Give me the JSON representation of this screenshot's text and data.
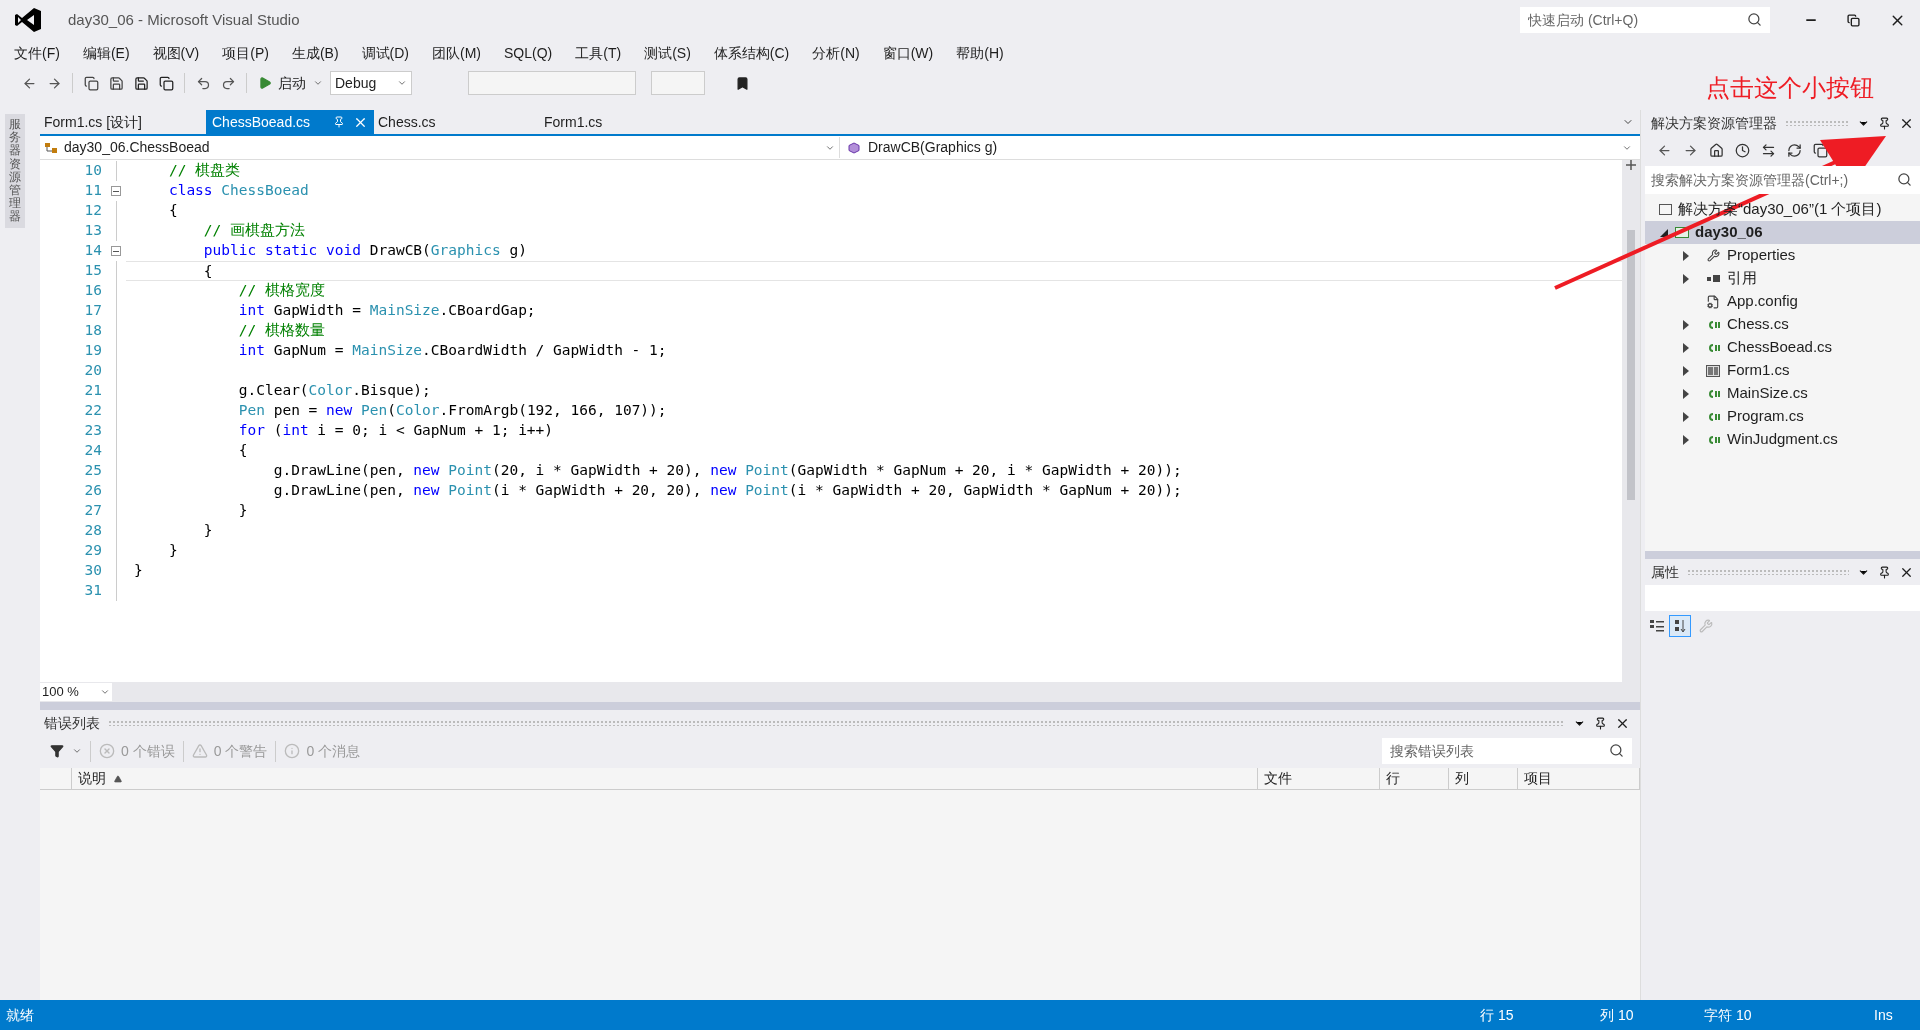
{
  "window": {
    "title": "day30_06 - Microsoft Visual Studio",
    "quick_launch": {
      "placeholder": "快速启动 (Ctrl+Q)"
    }
  },
  "menu": [
    "文件(F)",
    "编辑(E)",
    "视图(V)",
    "项目(P)",
    "生成(B)",
    "调试(D)",
    "团队(M)",
    "SQL(Q)",
    "工具(T)",
    "测试(S)",
    "体系结构(C)",
    "分析(N)",
    "窗口(W)",
    "帮助(H)"
  ],
  "toolbar": {
    "start_label": "启动",
    "configuration": "Debug"
  },
  "annotation": {
    "text": "点击这个小按钮"
  },
  "side_tab": "服务器资源管理器",
  "editor_tabs": [
    {
      "label": "Form1.cs [设计]",
      "selected": false
    },
    {
      "label": "ChessBoead.cs",
      "selected": true
    },
    {
      "label": "Chess.cs",
      "selected": false
    },
    {
      "label": "Form1.cs",
      "selected": false
    }
  ],
  "nav": {
    "type": "day30_06.ChessBoead",
    "member": "DrawCB(Graphics g)"
  },
  "code_lines": [
    {
      "number": "10",
      "current": false,
      "fold": false,
      "tokens": [
        {
          "kind": "comment",
          "text": "    // 棋盘类"
        }
      ]
    },
    {
      "number": "11",
      "current": false,
      "fold": true,
      "tokens": [
        {
          "kind": "keyword",
          "text": "    class"
        },
        {
          "kind": "type",
          "text": " ChessBoead"
        }
      ]
    },
    {
      "number": "12",
      "current": false,
      "fold": false,
      "tokens": [
        {
          "kind": "plain",
          "text": "    {"
        }
      ]
    },
    {
      "number": "13",
      "current": false,
      "fold": false,
      "tokens": [
        {
          "kind": "comment",
          "text": "        // 画棋盘方法"
        }
      ]
    },
    {
      "number": "14",
      "current": false,
      "fold": true,
      "tokens": [
        {
          "kind": "keyword",
          "text": "        public static void"
        },
        {
          "kind": "plain",
          "text": " DrawCB("
        },
        {
          "kind": "type",
          "text": "Graphics"
        },
        {
          "kind": "plain",
          "text": " g)"
        }
      ]
    },
    {
      "number": "15",
      "current": true,
      "fold": false,
      "tokens": [
        {
          "kind": "plain",
          "text": "        {"
        }
      ]
    },
    {
      "number": "16",
      "current": false,
      "fold": false,
      "tokens": [
        {
          "kind": "comment",
          "text": "            // 棋格宽度"
        }
      ]
    },
    {
      "number": "17",
      "current": false,
      "fold": false,
      "tokens": [
        {
          "kind": "keyword",
          "text": "            int"
        },
        {
          "kind": "plain",
          "text": " GapWidth = "
        },
        {
          "kind": "type",
          "text": "MainSize"
        },
        {
          "kind": "plain",
          "text": ".CBoardGap;"
        }
      ]
    },
    {
      "number": "18",
      "current": false,
      "fold": false,
      "tokens": [
        {
          "kind": "comment",
          "text": "            // 棋格数量"
        }
      ]
    },
    {
      "number": "19",
      "current": false,
      "fold": false,
      "tokens": [
        {
          "kind": "keyword",
          "text": "            int"
        },
        {
          "kind": "plain",
          "text": " GapNum = "
        },
        {
          "kind": "type",
          "text": "MainSize"
        },
        {
          "kind": "plain",
          "text": ".CBoardWidth / GapWidth - 1;"
        }
      ]
    },
    {
      "number": "20",
      "current": false,
      "fold": false
    },
    {
      "number": "21",
      "current": false,
      "fold": false,
      "tokens": [
        {
          "kind": "plain",
          "text": "            g.Clear("
        },
        {
          "kind": "type",
          "text": "Color"
        },
        {
          "kind": "plain",
          "text": ".Bisque);"
        }
      ]
    },
    {
      "number": "22",
      "current": false,
      "fold": false,
      "tokens": [
        {
          "kind": "type",
          "text": "            Pen"
        },
        {
          "kind": "plain",
          "text": " pen = "
        },
        {
          "kind": "keyword",
          "text": "new"
        },
        {
          "kind": "type",
          "text": " Pen"
        },
        {
          "kind": "plain",
          "text": "("
        },
        {
          "kind": "type",
          "text": "Color"
        },
        {
          "kind": "plain",
          "text": ".FromArgb(192, 166, 107));"
        }
      ]
    },
    {
      "number": "23",
      "current": false,
      "fold": false,
      "tokens": [
        {
          "kind": "keyword",
          "text": "            for"
        },
        {
          "kind": "plain",
          "text": " ("
        },
        {
          "kind": "keyword",
          "text": "int"
        },
        {
          "kind": "plain",
          "text": " i = 0; i < GapNum + 1; i++)"
        }
      ]
    },
    {
      "number": "24",
      "current": false,
      "fold": false,
      "tokens": [
        {
          "kind": "plain",
          "text": "            {"
        }
      ]
    },
    {
      "number": "25",
      "current": false,
      "fold": false,
      "tokens": [
        {
          "kind": "plain",
          "text": "                g.DrawLine(pen, "
        },
        {
          "kind": "keyword",
          "text": "new"
        },
        {
          "kind": "type",
          "text": " Point"
        },
        {
          "kind": "plain",
          "text": "(20, i * GapWidth + 20), "
        },
        {
          "kind": "keyword",
          "text": "new"
        },
        {
          "kind": "type",
          "text": " Point"
        },
        {
          "kind": "plain",
          "text": "(GapWidth * GapNum + 20, i * GapWidth + 20));"
        }
      ]
    },
    {
      "number": "26",
      "current": false,
      "fold": false,
      "tokens": [
        {
          "kind": "plain",
          "text": "                g.DrawLine(pen, "
        },
        {
          "kind": "keyword",
          "text": "new"
        },
        {
          "kind": "type",
          "text": " Point"
        },
        {
          "kind": "plain",
          "text": "(i * GapWidth + 20, 20), "
        },
        {
          "kind": "keyword",
          "text": "new"
        },
        {
          "kind": "type",
          "text": " Point"
        },
        {
          "kind": "plain",
          "text": "(i * GapWidth + 20, GapWidth * GapNum + 20));"
        }
      ]
    },
    {
      "number": "27",
      "current": false,
      "fold": false,
      "tokens": [
        {
          "kind": "plain",
          "text": "            }"
        }
      ]
    },
    {
      "number": "28",
      "current": false,
      "fold": false,
      "tokens": [
        {
          "kind": "plain",
          "text": "        }"
        }
      ]
    },
    {
      "number": "29",
      "current": false,
      "fold": false,
      "tokens": [
        {
          "kind": "plain",
          "text": "    }"
        }
      ]
    },
    {
      "number": "30",
      "current": false,
      "fold": false,
      "tokens": [
        {
          "kind": "plain",
          "text": "}"
        }
      ]
    },
    {
      "number": "31",
      "current": false,
      "fold": false
    }
  ],
  "zoom": "100 %",
  "error_list": {
    "title": "错误列表",
    "filters": [
      {
        "kind": "error",
        "label": "0 个错误"
      },
      {
        "kind": "warning",
        "label": "0 个警告"
      },
      {
        "kind": "info",
        "label": "0 个消息"
      }
    ],
    "search": {
      "placeholder": "搜索错误列表"
    },
    "columns": [
      "说明",
      "文件",
      "行",
      "列",
      "项目"
    ]
  },
  "solution_explorer": {
    "title": "解决方案资源管理器",
    "search": {
      "placeholder": "搜索解决方案资源管理器(Ctrl+;)"
    },
    "solution": "解决方案“day30_06”(1 个项目)",
    "project": {
      "label": "day30_06",
      "selected": true,
      "expanded": true,
      "children": [
        {
          "label": "Properties",
          "kind": "properties",
          "expandable": true
        },
        {
          "label": "引用",
          "kind": "references",
          "expandable": true
        },
        {
          "label": "App.config",
          "kind": "config",
          "expandable": false
        },
        {
          "label": "Chess.cs",
          "kind": "cs",
          "expandable": true
        },
        {
          "label": "ChessBoead.cs",
          "kind": "cs",
          "expandable": true
        },
        {
          "label": "Form1.cs",
          "kind": "form",
          "expandable": true
        },
        {
          "label": "MainSize.cs",
          "kind": "cs",
          "expandable": true
        },
        {
          "label": "Program.cs",
          "kind": "cs",
          "expandable": true
        },
        {
          "label": "WinJudgment.cs",
          "kind": "cs",
          "expandable": true
        }
      ]
    }
  },
  "properties": {
    "title": "属性"
  },
  "status_bar": {
    "status": "就绪",
    "line": "行 15",
    "column": "列 10",
    "char": "字符 10",
    "mode": "Ins"
  }
}
